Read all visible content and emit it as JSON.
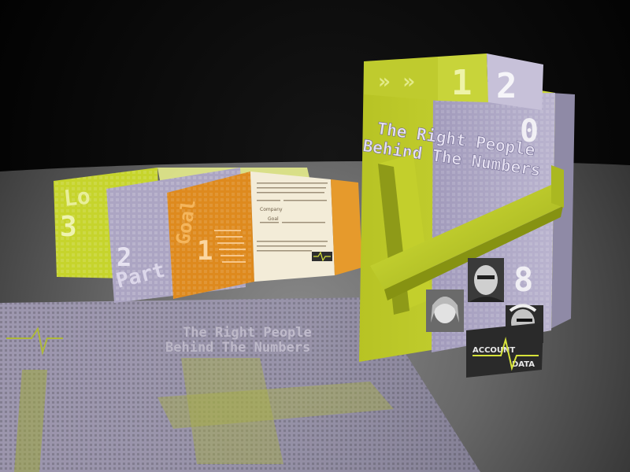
{
  "brochure": {
    "title_line1": "The Right People",
    "title_line2": "Behind The Numbers",
    "brand_top": "ACCOUNT",
    "brand_bottom": "DATA",
    "tab_digits": [
      "1",
      "2"
    ],
    "side_digits": [
      "0",
      "8"
    ]
  },
  "inserts": {
    "yellow_word": "Lo",
    "yellow_digit": "3",
    "lavender_digit": "2",
    "lavender_word": "Part",
    "orange_word": "Goal",
    "orange_digit": "1",
    "white_label_1": "Company",
    "white_label_2": "Goal"
  },
  "reflection": {
    "title_line1": "The Right People",
    "title_line2": "Behind The Numbers"
  },
  "colors": {
    "background": "#000000",
    "floor": "#6e6e6e",
    "lime": "#c2d12a",
    "lavender": "#a9a2c2",
    "orange": "#e08a1c",
    "cream": "#f1ead7"
  }
}
